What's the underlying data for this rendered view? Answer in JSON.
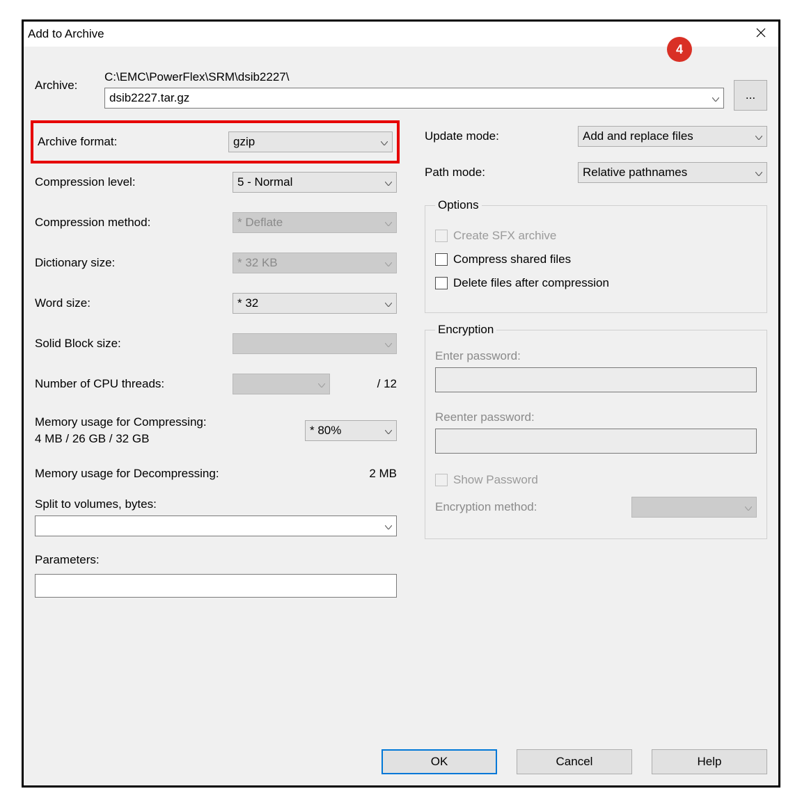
{
  "window": {
    "title": "Add to Archive"
  },
  "badge": "4",
  "archive": {
    "label": "Archive:",
    "path": "C:\\EMC\\PowerFlex\\SRM\\dsib2227\\",
    "filename": "dsib2227.tar.gz",
    "browse": "..."
  },
  "left": {
    "format": {
      "label": "Archive format:",
      "value": "gzip"
    },
    "level": {
      "label": "Compression level:",
      "value": "5 - Normal"
    },
    "method": {
      "label": "Compression method:",
      "value": "*  Deflate"
    },
    "dict": {
      "label": "Dictionary size:",
      "value": "*  32 KB"
    },
    "word": {
      "label": "Word size:",
      "value": "*  32"
    },
    "solid": {
      "label": "Solid Block size:",
      "value": ""
    },
    "threads": {
      "label": "Number of CPU threads:",
      "value": "",
      "suffix": "/ 12"
    },
    "memc": {
      "label": "Memory usage for Compressing:",
      "sub": "4 MB / 26 GB / 32 GB",
      "value": "* 80%"
    },
    "memd": {
      "label": "Memory usage for Decompressing:",
      "value": "2 MB"
    },
    "split": {
      "label": "Split to volumes, bytes:"
    },
    "params": {
      "label": "Parameters:"
    }
  },
  "right": {
    "update": {
      "label": "Update mode:",
      "value": "Add and replace files"
    },
    "path": {
      "label": "Path mode:",
      "value": "Relative pathnames"
    },
    "options": {
      "legend": "Options",
      "sfx": "Create SFX archive",
      "shared": "Compress shared files",
      "delete": "Delete files after compression"
    },
    "enc": {
      "legend": "Encryption",
      "enter": "Enter password:",
      "reenter": "Reenter password:",
      "show": "Show Password",
      "method": {
        "label": "Encryption method:",
        "value": ""
      }
    }
  },
  "buttons": {
    "ok": "OK",
    "cancel": "Cancel",
    "help": "Help"
  }
}
